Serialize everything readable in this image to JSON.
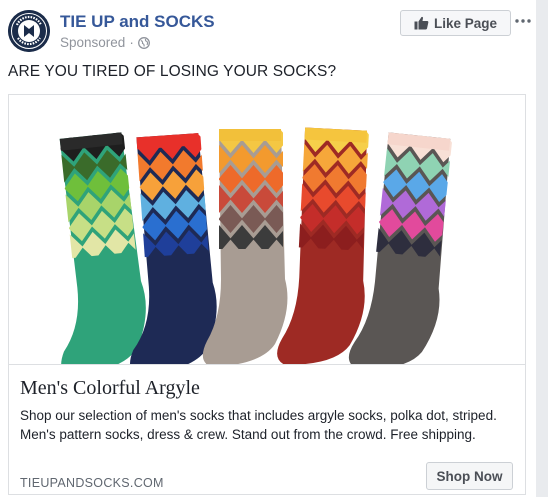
{
  "post": {
    "page_name": "TIE UP and SOCKS",
    "sponsored_label": "Sponsored",
    "separator": "·",
    "privacy_icon": "globe-icon",
    "like_button_label": "Like Page",
    "like_icon": "thumbs-up-icon",
    "more_icon": "more-options-icon",
    "text": "ARE YOU TIRED OF LOSING YOUR SOCKS?"
  },
  "avatar": {
    "icon": "tie-up-and-socks-logo",
    "logo_text_top": "TIE UP",
    "logo_text_bottom": "AND SOCKS"
  },
  "attachment": {
    "title": "Men's Colorful Argyle",
    "description": "Shop our selection of men's socks that includes argyle socks, polka dot, striped. Men's pattern socks, dress & crew. Stand out from the crowd. Free shipping.",
    "domain": "TIEUPANDSOCKS.COM",
    "cta_label": "Shop Now"
  },
  "socks": [
    {
      "name": "green-argyle-sock",
      "top": "#2a2a2a",
      "diamonds": [
        "#1e1e1e",
        "#3a6b2a",
        "#6fbf3b",
        "#a8d46a",
        "#c7df86",
        "#e2e6a6"
      ],
      "foot": "#2fa37a"
    },
    {
      "name": "navy-argyle-sock",
      "top": "#e8302a",
      "diamonds": [
        "#e8302a",
        "#f27a2d",
        "#f7a13a",
        "#5fb0e0",
        "#2a6fd0",
        "#1f3f9a"
      ],
      "foot": "#1e2a55"
    },
    {
      "name": "grey-argyle-sock",
      "top": "#f2c03a",
      "diamonds": [
        "#f4c743",
        "#f39a2e",
        "#ee6a2a",
        "#c94a3a",
        "#7a5a55",
        "#3c3c3c"
      ],
      "foot": "#a89c93"
    },
    {
      "name": "red-argyle-sock",
      "top": "#f5c53e",
      "diamonds": [
        "#f6cf4a",
        "#f6a73a",
        "#f07a30",
        "#e84a2d",
        "#c42d2a",
        "#8c1e1e"
      ],
      "foot": "#9e2a24"
    },
    {
      "name": "charcoal-argyle-sock",
      "top": "#f6d6cc",
      "diamonds": [
        "#f8e0d6",
        "#8fd3b3",
        "#5aa8e8",
        "#b06ad8",
        "#e24a9c",
        "#2e2e3e"
      ],
      "foot": "#5a5654"
    }
  ]
}
